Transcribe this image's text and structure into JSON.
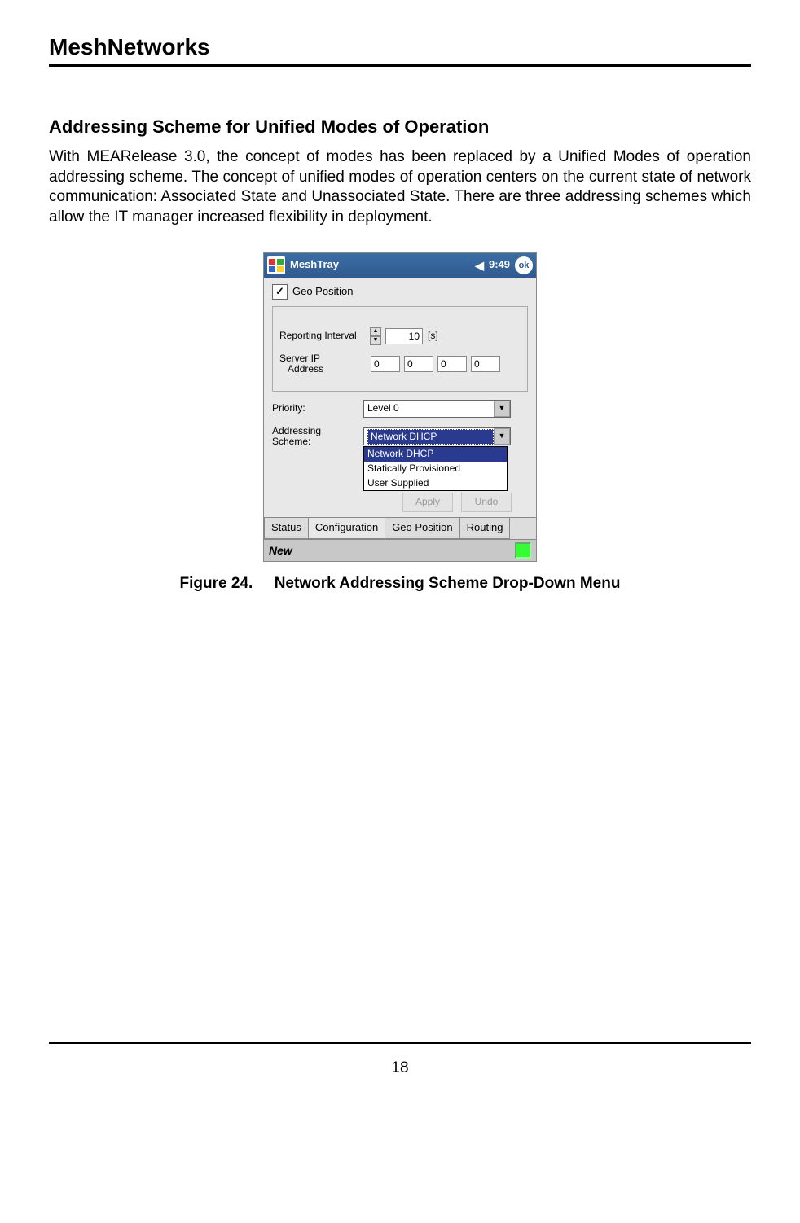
{
  "header": {
    "brand": "MeshNetworks"
  },
  "section": {
    "title": "Addressing Scheme for Unified Modes of Operation",
    "paragraph": "With MEARelease 3.0, the concept of modes has been replaced by a Unified Modes of operation addressing scheme. The concept of unified modes of operation centers on the current state of network communication: Associated State and Unassociated State. There are three addressing schemes which allow the IT manager increased flexibility in deployment."
  },
  "screenshot": {
    "titlebar": {
      "title": "MeshTray",
      "time": "9:49",
      "ok": "ok"
    },
    "checkbox": {
      "label": "Geo Position",
      "checked": "✓"
    },
    "reporting": {
      "label": "Reporting Interval",
      "value": "10",
      "unit": "[s]"
    },
    "server_ip": {
      "label1": "Server IP",
      "label2": "Address",
      "a": "0",
      "b": "0",
      "c": "0",
      "d": "0"
    },
    "priority": {
      "label": "Priority:",
      "value": "Level 0"
    },
    "addressing": {
      "label1": "Addressing",
      "label2": "Scheme:",
      "selected": "Network DHCP",
      "option1": "Network DHCP",
      "option2": "Statically Provisioned",
      "option3": "User Supplied"
    },
    "buttons": {
      "apply": "Apply",
      "undo": "Undo"
    },
    "tabs": {
      "t1": "Status",
      "t2": "Configuration",
      "t3": "Geo Position",
      "t4": "Routing"
    },
    "bottom": {
      "text": "New"
    }
  },
  "caption": {
    "figure": "Figure 24.",
    "text": "Network Addressing Scheme Drop-Down Menu"
  },
  "page_number": "18"
}
